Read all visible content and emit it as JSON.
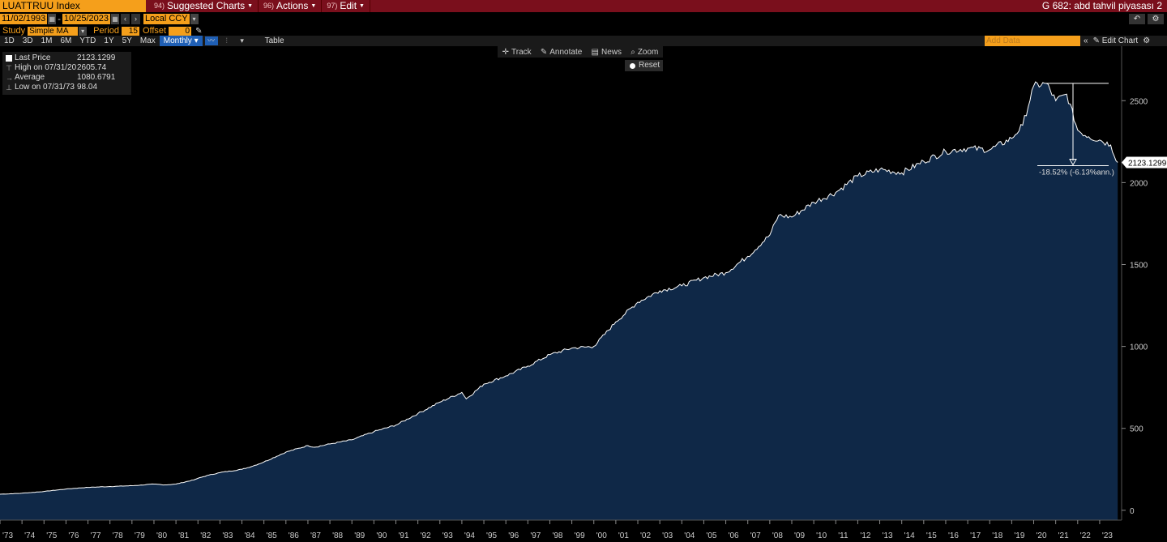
{
  "header": {
    "ticker": "LUATTRUU Index",
    "menus": [
      {
        "num": "94)",
        "label": "Suggested Charts"
      },
      {
        "num": "96)",
        "label": "Actions"
      },
      {
        "num": "97)",
        "label": "Edit"
      }
    ],
    "page_name": "G 682: abd tahvil piyasası 2"
  },
  "controls": {
    "start_date": "11/02/1993",
    "end_date": "10/25/2023",
    "currency": "Local CCY",
    "study_label": "Study",
    "study_value": "Simple MA",
    "period_label": "Period",
    "period_value": "15",
    "offset_label": "Offset",
    "offset_value": "0"
  },
  "toolbar": {
    "ranges": [
      "1D",
      "3D",
      "1M",
      "6M",
      "YTD",
      "1Y",
      "5Y",
      "Max"
    ],
    "frequency": "Monthly",
    "table_label": "Table",
    "add_data_placeholder": "Add Data",
    "edit_chart_label": "Edit Chart"
  },
  "legend": {
    "rows": [
      {
        "label": "Last Price",
        "value": "2123.1299"
      },
      {
        "label": "High on 07/31/20",
        "value": "2605.74"
      },
      {
        "label": "Average",
        "value": "1080.6791"
      },
      {
        "label": "Low on 07/31/73",
        "value": "98.04"
      }
    ]
  },
  "chart_tools": {
    "track": "Track",
    "annotate": "Annotate",
    "news": "News",
    "zoom": "Zoom",
    "reset": "Reset"
  },
  "chart_data": {
    "type": "area",
    "title": "",
    "xlabel": "",
    "ylabel": "",
    "ylim": [
      -60,
      2620
    ],
    "yticks": [
      0,
      500,
      1000,
      1500,
      2000,
      2500
    ],
    "xticks": [
      "'73",
      "'74",
      "'75",
      "'76",
      "'77",
      "'78",
      "'79",
      "'80",
      "'81",
      "'82",
      "'83",
      "'84",
      "'85",
      "'86",
      "'87",
      "'88",
      "'89",
      "'90",
      "'91",
      "'92",
      "'93",
      "'94",
      "'95",
      "'96",
      "'97",
      "'98",
      "'99",
      "'00",
      "'01",
      "'02",
      "'03",
      "'04",
      "'05",
      "'06",
      "'07",
      "'08",
      "'09",
      "'10",
      "'11",
      "'12",
      "'13",
      "'14",
      "'15",
      "'16",
      "'17",
      "'18",
      "'19",
      "'20",
      "'21",
      "'22",
      "'23"
    ],
    "xlim": [
      1973.0,
      2023.85
    ],
    "series": [
      {
        "x": [
          1973.0,
          1974,
          1975,
          1976,
          1977,
          1978,
          1979,
          1980,
          1980.5,
          1981,
          1981.8,
          1982,
          1982.5,
          1983,
          1984,
          1984.5,
          1985,
          1986,
          1987,
          1987.3,
          1988,
          1989,
          1990,
          1991,
          1992,
          1993,
          1994,
          1994.2,
          1995,
          1996,
          1997,
          1998,
          1999,
          2000,
          2001,
          2002,
          2003,
          2004,
          2005,
          2006,
          2007,
          2008,
          2008.4,
          2009,
          2010,
          2011,
          2012,
          2013,
          2014,
          2015,
          2016,
          2017,
          2018,
          2019,
          2019.5,
          2020.0,
          2020.58,
          2021,
          2021.5,
          2022,
          2022.5,
          2023,
          2023.5,
          2023.82
        ],
        "y": [
          98.04,
          104,
          115,
          130,
          140,
          145,
          150,
          160,
          155,
          160,
          185,
          195,
          215,
          230,
          250,
          270,
          295,
          355,
          395,
          385,
          405,
          430,
          480,
          520,
          590,
          660,
          720,
          680,
          770,
          820,
          880,
          950,
          990,
          1000,
          1150,
          1270,
          1340,
          1370,
          1420,
          1450,
          1550,
          1680,
          1800,
          1790,
          1880,
          1940,
          2040,
          2080,
          2060,
          2130,
          2190,
          2210,
          2200,
          2270,
          2350,
          2590,
          2605.74,
          2500,
          2540,
          2320,
          2280,
          2260,
          2230,
          2123.1299
        ]
      }
    ],
    "last_value_label": "2123.1299",
    "annotation": "-18.52% (-6.13%ann.)",
    "annotation_from": {
      "x": 2020.58,
      "y": 2605.74
    },
    "annotation_to": {
      "x": 2022.4,
      "y": 2123.1299
    },
    "colors": {
      "line": "#ffffff",
      "fill": "#0f2847",
      "axis_text": "#cccccc"
    }
  }
}
